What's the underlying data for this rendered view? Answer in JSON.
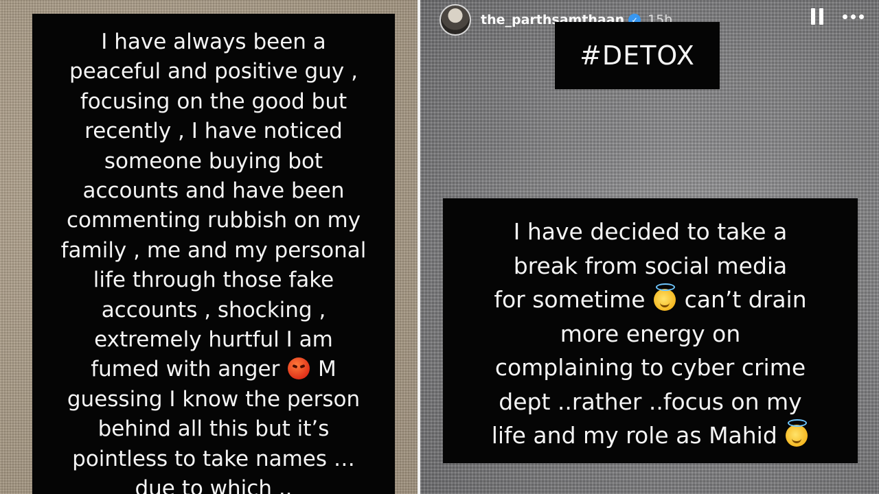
{
  "left_story": {
    "lines": [
      "I have always been a",
      "peaceful and positive guy ,",
      "focusing on the good but",
      "recently , I have noticed",
      "someone buying bot",
      "accounts and have been",
      "commenting rubbish on my",
      "family , me and my personal",
      "life through those fake",
      "accounts , shocking ,",
      "extremely hurtful I am",
      "guessing I know the person",
      "behind all this but it’s",
      "pointless to take names …",
      "due to which .."
    ],
    "line_fumed_a": "fumed with anger",
    "line_fumed_b": "M",
    "emoji_angry": "angry-face-emoji"
  },
  "right_story": {
    "header": {
      "username": "the_parthsamthaan",
      "time": "15h",
      "verified_icon": "verified-badge-icon",
      "pause_icon": "pause-icon",
      "more_icon": "more-options-icon"
    },
    "hashtag": "#DETOX",
    "lines": {
      "l1": "I have decided to take a",
      "l2": "break from social media",
      "l3a": "for sometime",
      "l3b": "can’t drain",
      "l4": "more energy on",
      "l5": "complaining to cyber crime",
      "l6": "dept ..rather ..focus on my",
      "l7": "life and my role as Mahid"
    },
    "emoji_halo": "smiling-face-with-halo-emoji"
  }
}
